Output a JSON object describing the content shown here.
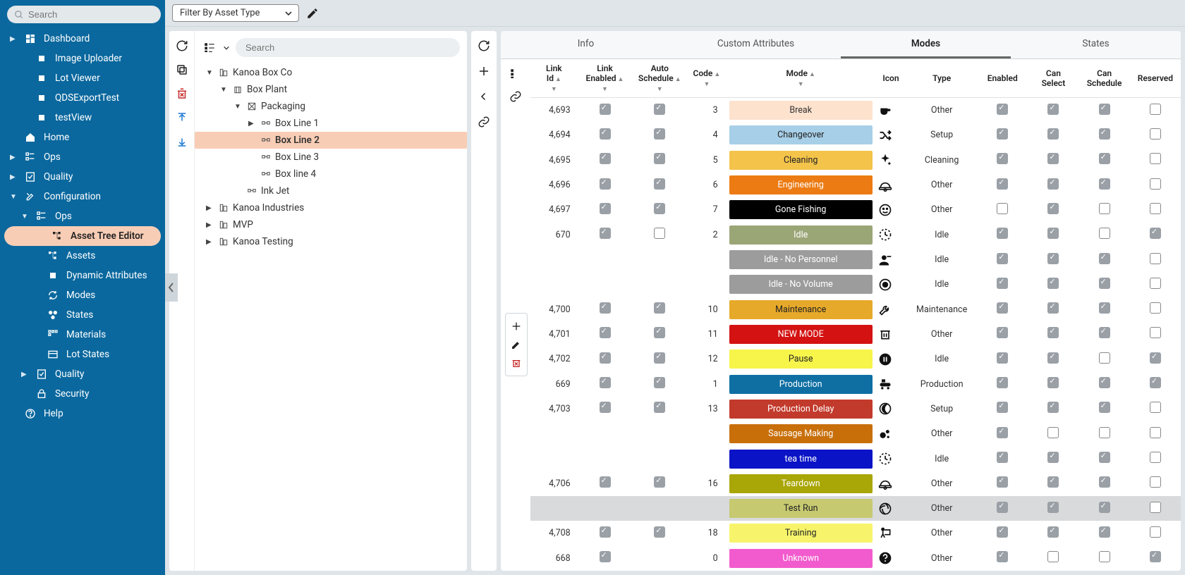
{
  "sidebar": {
    "search_placeholder": "Search",
    "items": [
      {
        "label": "Dashboard",
        "icon": "dashboard",
        "chev": "▶",
        "indent": 0
      },
      {
        "label": "Image Uploader",
        "icon": "square",
        "indent": 1
      },
      {
        "label": "Lot Viewer",
        "icon": "square",
        "indent": 1
      },
      {
        "label": "QDSExportTest",
        "icon": "square",
        "indent": 1
      },
      {
        "label": "testView",
        "icon": "square",
        "indent": 1
      },
      {
        "label": "Home",
        "icon": "home",
        "indent": 0
      },
      {
        "label": "Ops",
        "icon": "ops",
        "chev": "▶",
        "indent": 0
      },
      {
        "label": "Quality",
        "icon": "quality",
        "chev": "▶",
        "indent": 0
      },
      {
        "label": "Configuration",
        "icon": "tools",
        "chev": "▼",
        "indent": 0
      },
      {
        "label": "Ops",
        "icon": "ops",
        "chev": "▼",
        "indent": 1
      },
      {
        "label": "Asset Tree Editor",
        "icon": "tree",
        "indent": 2,
        "selected": true
      },
      {
        "label": "Assets",
        "icon": "tree",
        "indent": 2
      },
      {
        "label": "Dynamic Attributes",
        "icon": "square",
        "indent": 2
      },
      {
        "label": "Modes",
        "icon": "cycle",
        "indent": 2
      },
      {
        "label": "States",
        "icon": "states",
        "indent": 2
      },
      {
        "label": "Materials",
        "icon": "materials",
        "indent": 2
      },
      {
        "label": "Lot States",
        "icon": "lot",
        "indent": 2
      },
      {
        "label": "Quality",
        "icon": "quality",
        "chev": "▶",
        "indent": 1
      },
      {
        "label": "Security",
        "icon": "security",
        "indent": 1
      },
      {
        "label": "Help",
        "icon": "help",
        "indent": 0
      }
    ]
  },
  "topbar": {
    "filter_label": "Filter By Asset Type"
  },
  "tree": {
    "search_placeholder": "Search",
    "nodes": [
      {
        "label": "Kanoa Box Co",
        "depth": 1,
        "tw": "▼",
        "icon": "enterprise"
      },
      {
        "label": "Box Plant",
        "depth": 2,
        "tw": "▼",
        "icon": "site"
      },
      {
        "label": "Packaging",
        "depth": 3,
        "tw": "▼",
        "icon": "area"
      },
      {
        "label": "Box Line 1",
        "depth": 4,
        "tw": "▶",
        "icon": "line"
      },
      {
        "label": "Box Line 2",
        "depth": 4,
        "tw": "",
        "icon": "line",
        "selected": true
      },
      {
        "label": "Box Line 3",
        "depth": 4,
        "tw": "",
        "icon": "line"
      },
      {
        "label": "Box line 4",
        "depth": 4,
        "tw": "",
        "icon": "line"
      },
      {
        "label": "Ink Jet",
        "depth": 3,
        "tw": "",
        "icon": "line"
      },
      {
        "label": "Kanoa Industries",
        "depth": 1,
        "tw": "▶",
        "icon": "enterprise"
      },
      {
        "label": "MVP",
        "depth": 1,
        "tw": "▶",
        "icon": "enterprise"
      },
      {
        "label": "Kanoa Testing",
        "depth": 1,
        "tw": "▶",
        "icon": "enterprise"
      }
    ]
  },
  "tabs": [
    "Info",
    "Custom Attributes",
    "Modes",
    "States"
  ],
  "active_tab": 2,
  "grid": {
    "headers": [
      "Link Id",
      "Link Enabled",
      "Auto Schedule",
      "Code",
      "Mode",
      "Icon",
      "Type",
      "Enabled",
      "Can Select",
      "Can Schedule",
      "Reserved"
    ],
    "rows": [
      {
        "link_id": "4,693",
        "link_enabled": true,
        "auto_schedule": true,
        "code": "3",
        "mode": "Break",
        "mode_bg": "#fde2ce",
        "mode_fg": "#333",
        "icon": "cup",
        "type": "Other",
        "enabled": true,
        "can_select": true,
        "can_schedule": true,
        "reserved": false
      },
      {
        "link_id": "4,694",
        "link_enabled": true,
        "auto_schedule": true,
        "code": "4",
        "mode": "Changeover",
        "mode_bg": "#a7cfe8",
        "mode_fg": "#222",
        "icon": "shuffle",
        "type": "Setup",
        "enabled": true,
        "can_select": true,
        "can_schedule": true,
        "reserved": false
      },
      {
        "link_id": "4,695",
        "link_enabled": true,
        "auto_schedule": true,
        "code": "5",
        "mode": "Cleaning",
        "mode_bg": "#f3c34a",
        "mode_fg": "#222",
        "icon": "sparkle",
        "type": "Cleaning",
        "enabled": true,
        "can_select": true,
        "can_schedule": true,
        "reserved": false
      },
      {
        "link_id": "4,696",
        "link_enabled": true,
        "auto_schedule": true,
        "code": "6",
        "mode": "Engineering",
        "mode_bg": "#ec7b13",
        "mode_fg": "#fff",
        "icon": "hardhat",
        "type": "Other",
        "enabled": true,
        "can_select": true,
        "can_schedule": true,
        "reserved": false
      },
      {
        "link_id": "4,697",
        "link_enabled": true,
        "auto_schedule": true,
        "code": "7",
        "mode": "Gone Fishing",
        "mode_bg": "#000000",
        "mode_fg": "#fff",
        "icon": "smile",
        "type": "Other",
        "enabled": false,
        "can_select": true,
        "can_schedule": false,
        "reserved": false
      },
      {
        "link_id": "670",
        "link_enabled": true,
        "auto_schedule": false,
        "code": "2",
        "mode": "Idle",
        "mode_bg": "#9ba677",
        "mode_fg": "#fff",
        "icon": "clock-dash",
        "type": "Idle",
        "enabled": true,
        "can_select": true,
        "can_schedule": false,
        "reserved": true
      },
      {
        "link_id": "",
        "link_enabled": null,
        "auto_schedule": null,
        "code": "",
        "mode": "Idle - No Personnel",
        "mode_bg": "#9c9c9c",
        "mode_fg": "#fff",
        "icon": "person-minus",
        "type": "Idle",
        "enabled": true,
        "can_select": true,
        "can_schedule": true,
        "reserved": false
      },
      {
        "link_id": "",
        "link_enabled": null,
        "auto_schedule": null,
        "code": "",
        "mode": "Idle - No Volume",
        "mode_bg": "#9c9c9c",
        "mode_fg": "#fff",
        "icon": "target",
        "type": "Idle",
        "enabled": true,
        "can_select": true,
        "can_schedule": true,
        "reserved": false
      },
      {
        "link_id": "4,700",
        "link_enabled": true,
        "auto_schedule": true,
        "code": "10",
        "mode": "Maintenance",
        "mode_bg": "#e7a92a",
        "mode_fg": "#222",
        "icon": "wrench",
        "type": "Maintenance",
        "enabled": true,
        "can_select": true,
        "can_schedule": true,
        "reserved": false
      },
      {
        "link_id": "4,701",
        "link_enabled": true,
        "auto_schedule": true,
        "code": "11",
        "mode": "NEW MODE",
        "mode_bg": "#d41212",
        "mode_fg": "#fff",
        "icon": "trash",
        "type": "Other",
        "enabled": true,
        "can_select": true,
        "can_schedule": true,
        "reserved": false
      },
      {
        "link_id": "4,702",
        "link_enabled": true,
        "auto_schedule": true,
        "code": "12",
        "mode": "Pause",
        "mode_bg": "#f7f44a",
        "mode_fg": "#222",
        "icon": "pause",
        "type": "Idle",
        "enabled": true,
        "can_select": true,
        "can_schedule": false,
        "reserved": true
      },
      {
        "link_id": "669",
        "link_enabled": true,
        "auto_schedule": true,
        "code": "1",
        "mode": "Production",
        "mode_bg": "#0f6fa3",
        "mode_fg": "#fff",
        "icon": "conveyor",
        "type": "Production",
        "enabled": true,
        "can_select": true,
        "can_schedule": true,
        "reserved": true
      },
      {
        "link_id": "4,703",
        "link_enabled": true,
        "auto_schedule": true,
        "code": "13",
        "mode": "Production Delay",
        "mode_bg": "#c23a2c",
        "mode_fg": "#fff",
        "icon": "moon",
        "type": "Setup",
        "enabled": true,
        "can_select": true,
        "can_schedule": true,
        "reserved": false
      },
      {
        "link_id": "",
        "link_enabled": null,
        "auto_schedule": null,
        "code": "",
        "mode": "Sausage Making",
        "mode_bg": "#c86f0a",
        "mode_fg": "#fff",
        "icon": "bubbles",
        "type": "Other",
        "enabled": true,
        "can_select": false,
        "can_schedule": false,
        "reserved": false
      },
      {
        "link_id": "",
        "link_enabled": null,
        "auto_schedule": null,
        "code": "",
        "mode": "tea time",
        "mode_bg": "#0a13c6",
        "mode_fg": "#fff",
        "icon": "clock-dash",
        "type": "Idle",
        "enabled": true,
        "can_select": true,
        "can_schedule": true,
        "reserved": false
      },
      {
        "link_id": "4,706",
        "link_enabled": true,
        "auto_schedule": true,
        "code": "16",
        "mode": "Teardown",
        "mode_bg": "#a9a607",
        "mode_fg": "#fff",
        "icon": "hardhat",
        "type": "Other",
        "enabled": true,
        "can_select": true,
        "can_schedule": true,
        "reserved": false
      },
      {
        "link_id": "",
        "link_enabled": null,
        "auto_schedule": null,
        "code": "",
        "mode": "Test Run",
        "mode_bg": "#c6c970",
        "mode_fg": "#222",
        "icon": "volleyball",
        "type": "Other",
        "enabled": true,
        "can_select": true,
        "can_schedule": true,
        "reserved": false,
        "hl": true
      },
      {
        "link_id": "4,708",
        "link_enabled": true,
        "auto_schedule": true,
        "code": "18",
        "mode": "Training",
        "mode_bg": "#f7f46b",
        "mode_fg": "#222",
        "icon": "presentation",
        "type": "Other",
        "enabled": true,
        "can_select": true,
        "can_schedule": true,
        "reserved": false
      },
      {
        "link_id": "668",
        "link_enabled": true,
        "auto_schedule": null,
        "code": "0",
        "mode": "Unknown",
        "mode_bg": "#f25bcd",
        "mode_fg": "#fff",
        "icon": "question",
        "type": "Other",
        "enabled": true,
        "can_select": false,
        "can_schedule": false,
        "reserved": true
      }
    ]
  }
}
